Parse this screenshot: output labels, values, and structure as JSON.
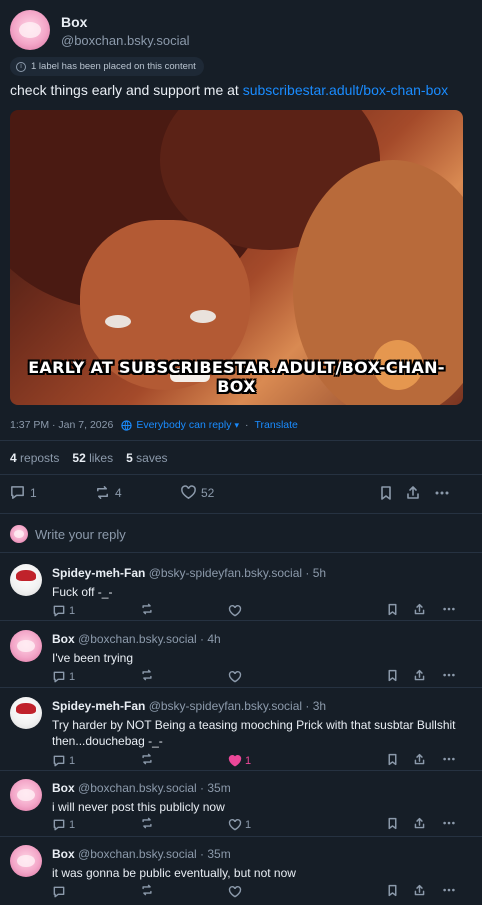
{
  "post": {
    "author_name": "Box",
    "author_handle": "@boxchan.bsky.social",
    "label_notice": "1 label has been placed on this content",
    "text_prefix": "check things early and support me at ",
    "text_link": "subscribestar.adult/box-chan-box",
    "image_caption": "EARLY AT SUBSCRIBESTAR.ADULT/BOX-CHAN-BOX",
    "timestamp": "1:37 PM · Jan 7, 2026",
    "reply_setting": "Everybody can reply",
    "translate": "Translate",
    "stats": {
      "reposts_count": "4",
      "reposts_label": "reposts",
      "likes_count": "52",
      "likes_label": "likes",
      "saves_count": "5",
      "saves_label": "saves"
    },
    "actions": {
      "replies": "1",
      "reposts": "4",
      "likes": "52"
    }
  },
  "reply_box": {
    "placeholder": "Write your reply"
  },
  "replies": [
    {
      "name": "Spidey-meh-Fan",
      "handle": "@bsky-spideyfan.bsky.social",
      "time": "· 5h",
      "text": "Fuck off -_-",
      "reply_count": "1",
      "like_count": "",
      "liked": false
    },
    {
      "name": "Box",
      "handle": "@boxchan.bsky.social",
      "time": "· 4h",
      "text": "I've been trying",
      "reply_count": "1",
      "like_count": "",
      "liked": false
    },
    {
      "name": "Spidey-meh-Fan",
      "handle": "@bsky-spideyfan.bsky.social",
      "time": "· 3h",
      "text": "Try harder by NOT Being a teasing mooching Prick with that susbtar Bullshit then...douchebag -_-",
      "reply_count": "1",
      "like_count": "1",
      "liked": true
    },
    {
      "name": "Box",
      "handle": "@boxchan.bsky.social",
      "time": "· 35m",
      "text": "i will never post this publicly now",
      "reply_count": "1",
      "like_count": "1",
      "liked": false
    },
    {
      "name": "Box",
      "handle": "@boxchan.bsky.social",
      "time": "· 35m",
      "text": "it was gonna be public eventually, but not now",
      "reply_count": "",
      "like_count": "",
      "liked": false
    }
  ],
  "colors": {
    "background": "#161e27",
    "accent": "#1a8cff",
    "liked": "#ec4899",
    "muted": "#8c9aab"
  },
  "icons": [
    "info-icon",
    "globe-reply-icon",
    "reply-icon",
    "repost-icon",
    "heart-icon",
    "bookmark-icon",
    "share-icon",
    "more-icon"
  ]
}
